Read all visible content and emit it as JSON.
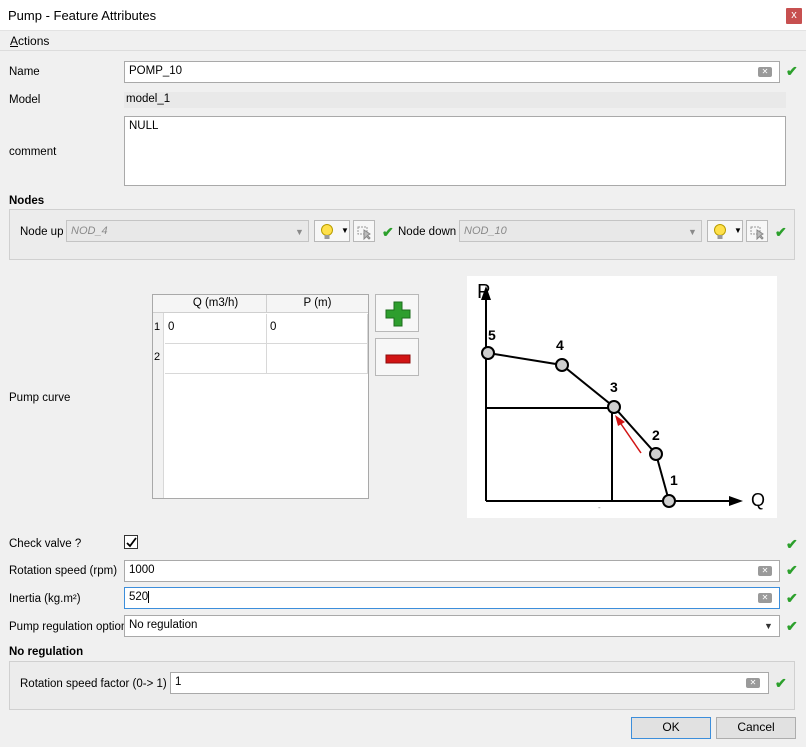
{
  "window": {
    "title": "Pump - Feature Attributes",
    "close_glyph": "x"
  },
  "menu": {
    "actions_first": "A",
    "actions_rest": "ctions"
  },
  "fields": {
    "name": {
      "label": "Name",
      "value": "POMP_10"
    },
    "model": {
      "label": "Model",
      "value": "model_1"
    },
    "comment": {
      "label": "comment",
      "value": "NULL"
    }
  },
  "nodes": {
    "section": "Nodes",
    "node_up": {
      "label": "Node up",
      "value": "NOD_4"
    },
    "node_down": {
      "label": "Node down",
      "value": "NOD_10"
    }
  },
  "pump_curve": {
    "label": "Pump curve",
    "columns": [
      "Q (m3/h)",
      "P (m)"
    ],
    "rows": [
      {
        "index": "1",
        "q": "0",
        "p": "0"
      },
      {
        "index": "2",
        "q": "",
        "p": ""
      }
    ]
  },
  "diagram": {
    "axis_p": "P",
    "axis_q": "Q",
    "points": [
      "1",
      "2",
      "3",
      "4",
      "5"
    ],
    "dash": "-"
  },
  "lower": {
    "check_valve": {
      "label": "Check valve ?",
      "checked": true
    },
    "rotation_speed": {
      "label": "Rotation speed (rpm)",
      "value": "1000"
    },
    "inertia": {
      "label": "Inertia (kg.m²)",
      "value": "520"
    },
    "regulation": {
      "label": "Pump regulation option",
      "value": "No regulation"
    }
  },
  "no_regulation": {
    "section": "No regulation",
    "speed_factor": {
      "label": "Rotation speed factor (0-> 1)",
      "value": "1"
    }
  },
  "buttons": {
    "ok": "OK",
    "cancel": "Cancel"
  },
  "colors": {
    "check": "#2ca02c",
    "plus": "#2e9e2e",
    "minus": "#d11414",
    "focus": "#3c8edb"
  }
}
